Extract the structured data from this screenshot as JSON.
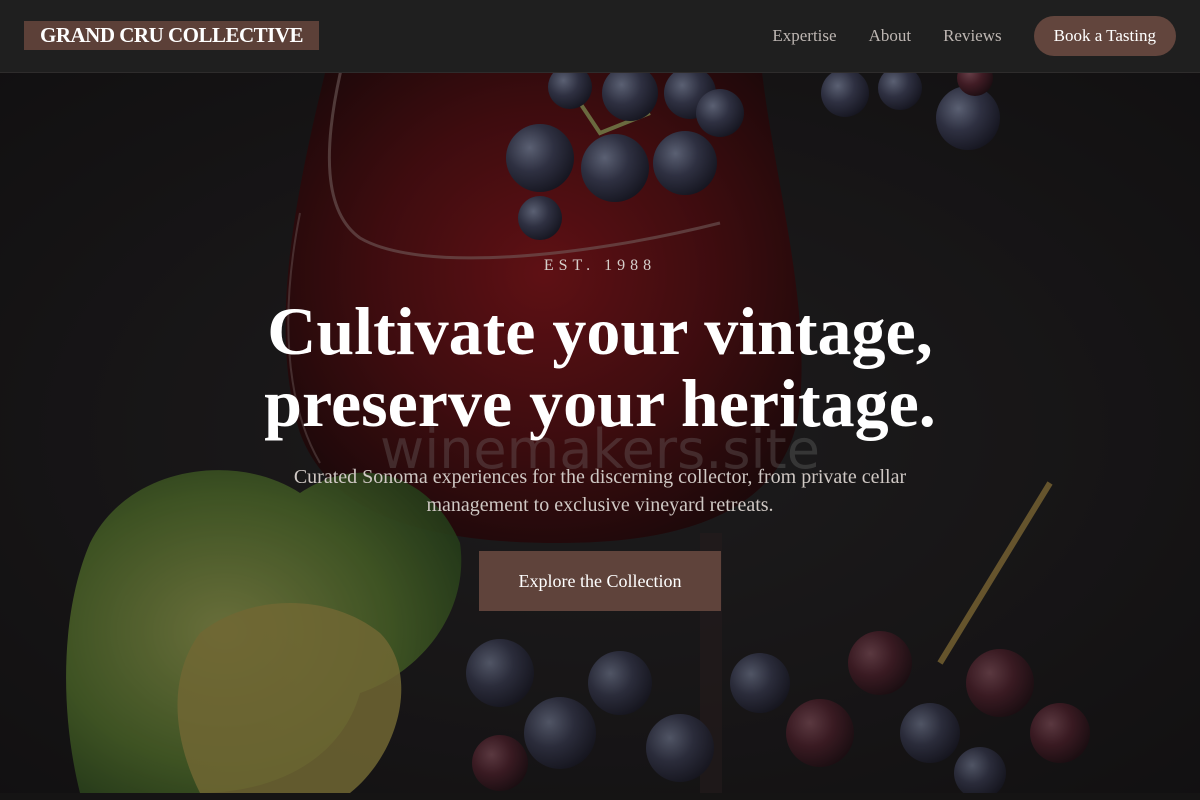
{
  "nav": {
    "brand": "GRAND CRU COLLECTIVE",
    "links": [
      "Expertise",
      "About",
      "Reviews"
    ],
    "cta": "Book a Tasting"
  },
  "hero": {
    "eyebrow": "EST. 1988",
    "headline_line1": "Cultivate your vintage,",
    "headline_line2": "preserve your heritage.",
    "subhead": "Curated Sonoma experiences for the discerning collector, from private cellar management to exclusive vineyard retreats.",
    "cta": "Explore the Collection",
    "watermark": "winemakers.site",
    "background_image": "red-wine-glass-with-grapes-photo"
  },
  "colors": {
    "accent": "#5f433b",
    "nav_bg": "#1f1f1f",
    "text_light": "#ffffff",
    "text_muted": "#cfc8c4"
  }
}
